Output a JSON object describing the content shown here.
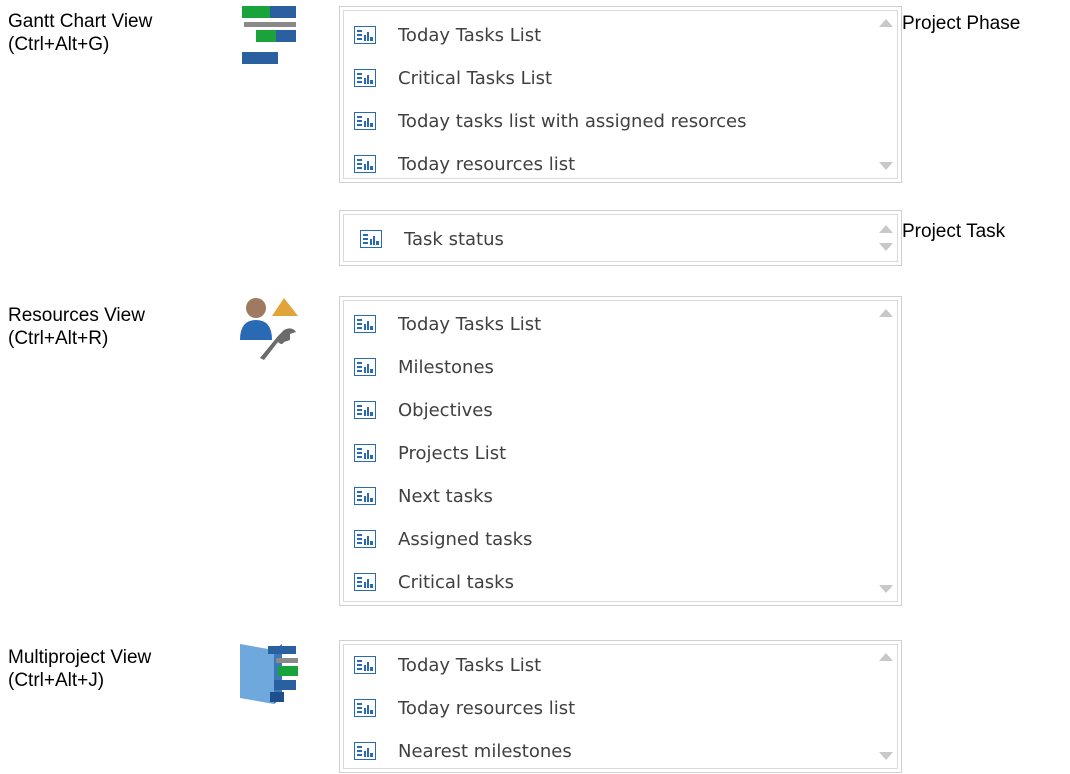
{
  "views": [
    {
      "label_line1": "Gantt Chart View",
      "label_line2": "(Ctrl+Alt+G)",
      "icon": "gantt-chart-icon",
      "side_label": "Project Phase",
      "items": [
        "Today Tasks List",
        "Critical Tasks List",
        "Today tasks list with assigned resorces",
        "Today resources list"
      ]
    },
    {
      "side_label": "Project Task",
      "items": [
        "Task status"
      ]
    },
    {
      "label_line1": "Resources View",
      "label_line2": "(Ctrl+Alt+R)",
      "icon": "resources-icon",
      "items": [
        "Today Tasks List",
        "Milestones",
        "Objectives",
        "Projects List",
        "Next tasks",
        "Assigned tasks",
        "Critical tasks"
      ]
    },
    {
      "label_line1": "Multiproject View",
      "label_line2": "(Ctrl+Alt+J)",
      "icon": "multiproject-icon",
      "items": [
        "Today Tasks List",
        "Today resources list",
        "Nearest milestones"
      ]
    }
  ],
  "item_icon": "report-icon",
  "colors": {
    "green": "#1aa33a",
    "blue": "#2a5fa0",
    "orange": "#e2a33a",
    "border": "#d0d0d0",
    "text": "#404040"
  }
}
